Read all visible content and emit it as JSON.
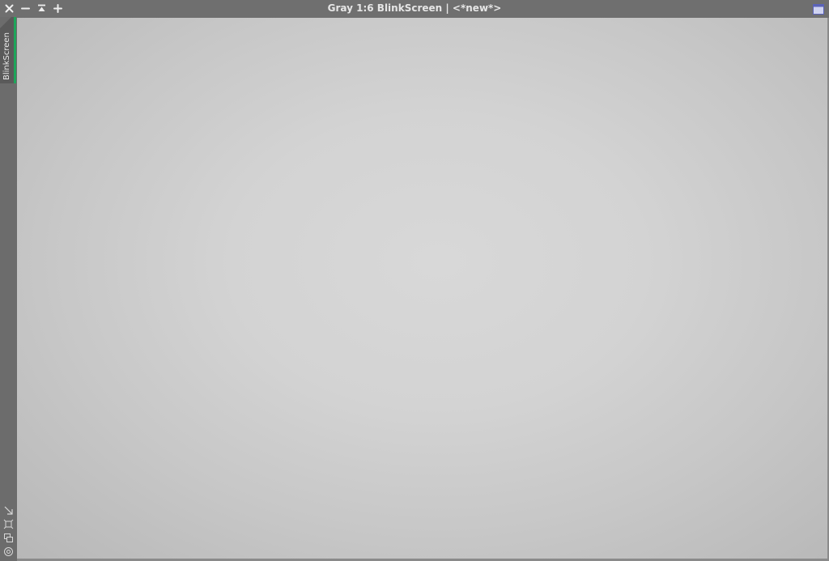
{
  "window": {
    "title": "Gray 1:6 BlinkScreen | <*new*>"
  },
  "titlebar": {
    "buttons": [
      {
        "name": "close",
        "icon": "close-icon"
      },
      {
        "name": "minimize",
        "icon": "minus-icon"
      },
      {
        "name": "shade",
        "icon": "collapse-up-icon"
      },
      {
        "name": "maximize",
        "icon": "plus-icon"
      }
    ],
    "right_icon": "restore-window-icon"
  },
  "sidebar": {
    "tab_label": "BlinkScreen",
    "tab_accent": "#1ea55a",
    "tools": [
      {
        "name": "fit-to-window",
        "icon": "diagonal-arrow-icon"
      },
      {
        "name": "crop-preview",
        "icon": "crop-icon"
      },
      {
        "name": "clone-view",
        "icon": "copy-windows-icon"
      },
      {
        "name": "target",
        "icon": "target-icon"
      }
    ]
  },
  "colors": {
    "frame": "#6e6e6e",
    "canvas_center": "#d8d8d8",
    "canvas_edge": "#b7b7b7",
    "title_text": "#e6e6e6"
  }
}
